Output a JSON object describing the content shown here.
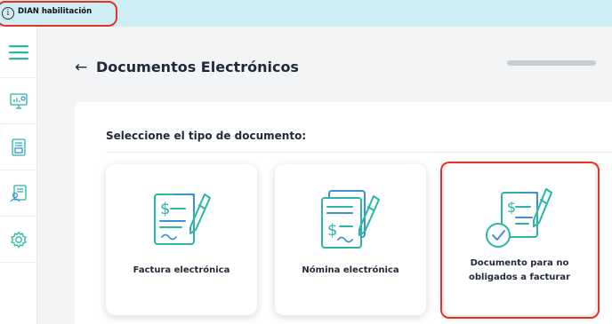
{
  "topbar": {
    "info_icon": "i",
    "environment_label": "DIAN habilitación"
  },
  "sidebar": {
    "items": [
      {
        "name": "menu",
        "icon": "hamburger-icon"
      },
      {
        "name": "dashboard",
        "icon": "monitor-chart-icon"
      },
      {
        "name": "documents",
        "icon": "document-list-icon"
      },
      {
        "name": "reports",
        "icon": "report-person-icon"
      },
      {
        "name": "settings",
        "icon": "gear-icon"
      }
    ]
  },
  "header": {
    "back_icon": "←",
    "title": "Documentos Electrónicos"
  },
  "content": {
    "subtitle": "Seleccione el tipo de documento:",
    "cards": [
      {
        "label": "Factura electrónica",
        "icon": "invoice-pen-icon"
      },
      {
        "label": "Nómina electrónica",
        "icon": "payroll-pen-icon"
      },
      {
        "label": "Documento para no obligados a facturar",
        "icon": "document-check-pen-icon"
      }
    ]
  },
  "colors": {
    "accent_teal": "#2bb5a7",
    "accent_blue": "#3f8fd6",
    "highlight": "#e53223",
    "topbar_bg": "#cfedf4"
  }
}
